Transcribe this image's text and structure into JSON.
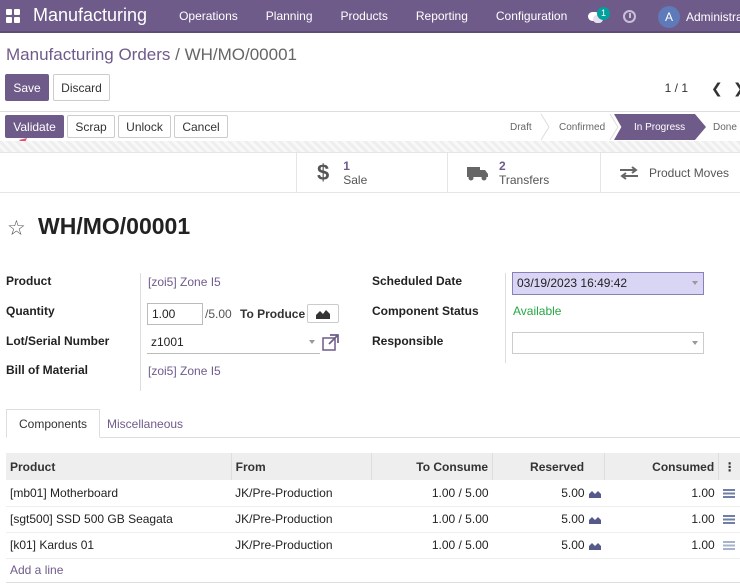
{
  "nav": {
    "brand": "Manufacturing",
    "menu": [
      "Operations",
      "Planning",
      "Products",
      "Reporting",
      "Configuration"
    ],
    "chat_badge": "1",
    "avatar_letter": "A",
    "user": "Administrator"
  },
  "breadcrumb": {
    "parent": "Manufacturing Orders",
    "separator": " / ",
    "current": "WH/MO/00001"
  },
  "controls": {
    "save": "Save",
    "discard": "Discard",
    "pager": "1 / 1"
  },
  "actions": {
    "validate": "Validate",
    "scrap": "Scrap",
    "unlock": "Unlock",
    "cancel": "Cancel"
  },
  "stages": {
    "draft": "Draft",
    "confirmed": "Confirmed",
    "in_progress": "In Progress",
    "done": "Done"
  },
  "smart_buttons": {
    "sale": {
      "count": "1",
      "label": "Sale"
    },
    "transfers": {
      "count": "2",
      "label": "Transfers"
    },
    "moves": {
      "label": "Product Moves"
    }
  },
  "record": {
    "title": "WH/MO/00001"
  },
  "fields": {
    "product_label": "Product",
    "product_value": "[zoi5] Zone I5",
    "quantity_label": "Quantity",
    "quantity_value": "1.00",
    "quantity_total": "/5.00",
    "to_produce": "To Produce",
    "lot_label": "Lot/Serial Number",
    "lot_value": "z1001",
    "bom_label": "Bill of Material",
    "bom_value": "[zoi5] Zone I5",
    "scheduled_label": "Scheduled Date",
    "scheduled_value": "03/19/2023 16:49:42",
    "component_status_label": "Component Status",
    "component_status_value": "Available",
    "responsible_label": "Responsible",
    "responsible_value": ""
  },
  "tabs": {
    "components": "Components",
    "misc": "Miscellaneous"
  },
  "table": {
    "headers": {
      "product": "Product",
      "from": "From",
      "to_consume": "To Consume",
      "reserved": "Reserved",
      "consumed": "Consumed"
    },
    "rows": [
      {
        "product": "[mb01] Motherboard",
        "from": "JK/Pre-Production",
        "to_consume": "1.00 / 5.00",
        "reserved": "5.00",
        "consumed": "1.00"
      },
      {
        "product": "[sgt500] SSD 500 GB Seagata",
        "from": "JK/Pre-Production",
        "to_consume": "1.00 / 5.00",
        "reserved": "5.00",
        "consumed": "1.00"
      },
      {
        "product": "[k01] Kardus 01",
        "from": "JK/Pre-Production",
        "to_consume": "1.00 / 5.00",
        "reserved": "5.00",
        "consumed": "1.00"
      }
    ],
    "add_line": "Add a line"
  },
  "colors": {
    "primary": "#6f5b8a",
    "green": "#28a745",
    "date_highlight": "#d9d5f5"
  }
}
